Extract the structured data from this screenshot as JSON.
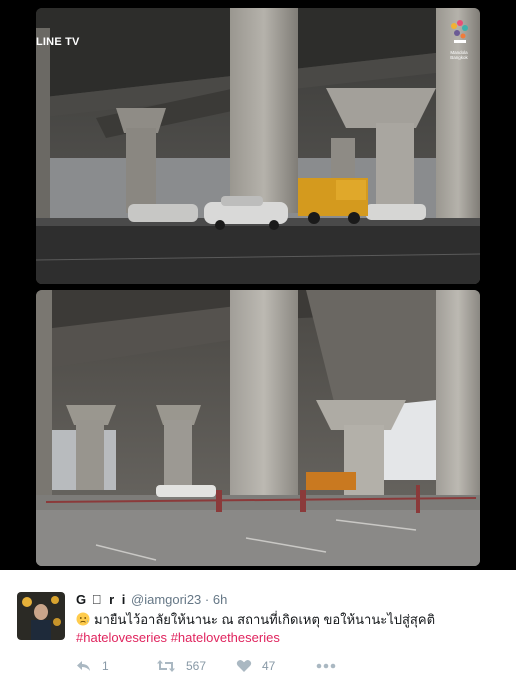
{
  "media": {
    "watermark": "LINE TV",
    "brand_lines": [
      "Mandola",
      "Bangkok"
    ]
  },
  "tweet": {
    "display_name": "G ⃞ r i",
    "handle": "@iamgori23",
    "separator": "·",
    "time": "6h",
    "text": "มายืนไว้อาลัยให้นานะ ณ สถานที่เกิดเหตุ ขอให้นานะไปสู่สุคติ",
    "hashtags": [
      "#hateloveseries",
      "#hatelovetheseries"
    ],
    "actions": {
      "reply_count": "1",
      "retweet_count": "567",
      "like_count": "47"
    }
  },
  "colors": {
    "hashtag": "#e0245e",
    "muted": "#657786",
    "action_icon": "#aab8c2"
  }
}
